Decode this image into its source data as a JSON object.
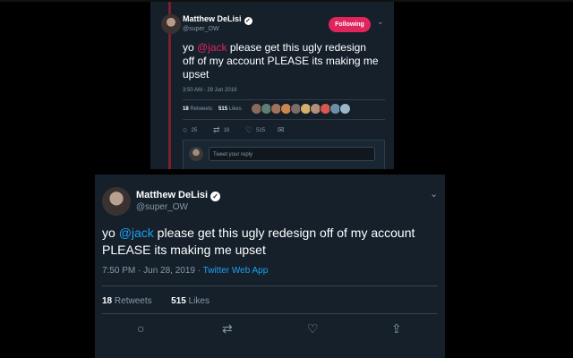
{
  "upper_tweet": {
    "name": "Matthew DeLisi",
    "handle": "@super_OW",
    "follow_label": "Following",
    "text_before": "yo ",
    "mention": "@jack",
    "text_after": " please get this ugly redesign off of my account PLEASE its making me upset",
    "timestamp": "3:50 AM - 29 Jun 2019",
    "retweets_count": "18",
    "retweets_label": "Retweets",
    "likes_count": "515",
    "likes_label": "Likes",
    "liker_avatar_colors": [
      "#8a6a58",
      "#5f7f74",
      "#a0725b",
      "#c9884e",
      "#7d6a6b",
      "#d6b16a",
      "#b58f76",
      "#d9574f",
      "#6d8fa6",
      "#9bb7c9"
    ],
    "reply_count": "25",
    "retweet_count": "18",
    "like_count": "515",
    "reply_placeholder": "Tweet your reply",
    "accent_color": "#e0245e"
  },
  "lower_tweet": {
    "name": "Matthew DeLisi",
    "handle": "@super_OW",
    "text_before": "yo ",
    "mention": "@jack",
    "text_after": " please get this ugly redesign off of my account PLEASE its making me upset",
    "timestamp": "7:50 PM · Jun 28, 2019 · ",
    "source_app": "Twitter Web App",
    "retweets_count": "18",
    "retweets_label": "Retweets",
    "likes_count": "515",
    "likes_label": "Likes",
    "accent_color": "#1da1f2"
  }
}
